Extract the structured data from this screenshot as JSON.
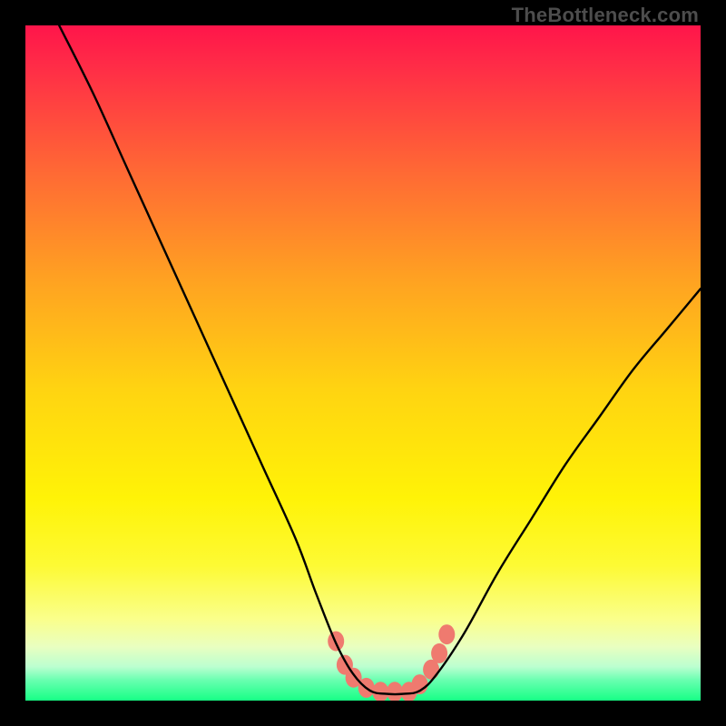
{
  "watermark": "TheBottleneck.com",
  "colors": {
    "frame": "#000000",
    "curve": "#000000",
    "beads": "#ef7a6f",
    "gradient_top": "#ff154a",
    "gradient_bottom": "#17ff85"
  },
  "chart_data": {
    "type": "line",
    "title": "",
    "xlabel": "",
    "ylabel": "",
    "xlim": [
      0,
      100
    ],
    "ylim": [
      0,
      100
    ],
    "grid": false,
    "legend": false,
    "annotations": [
      "TheBottleneck.com"
    ],
    "series": [
      {
        "name": "curve",
        "x": [
          5,
          10,
          15,
          20,
          25,
          30,
          35,
          40,
          43,
          46,
          48.5,
          51,
          53.5,
          56,
          58.5,
          61,
          65,
          70,
          75,
          80,
          85,
          90,
          95,
          100
        ],
        "y": [
          100,
          90,
          79,
          68,
          57,
          46,
          35,
          24,
          16,
          8.5,
          4,
          1.5,
          1,
          1,
          1.5,
          4,
          10,
          19,
          27,
          35,
          42,
          49,
          55,
          61
        ]
      }
    ],
    "beads": [
      {
        "x": 46.0,
        "y": 8.8
      },
      {
        "x": 47.3,
        "y": 5.3
      },
      {
        "x": 48.6,
        "y": 3.4
      },
      {
        "x": 50.5,
        "y": 1.9
      },
      {
        "x": 52.6,
        "y": 1.3
      },
      {
        "x": 54.7,
        "y": 1.3
      },
      {
        "x": 56.8,
        "y": 1.3
      },
      {
        "x": 58.4,
        "y": 2.4
      },
      {
        "x": 60.1,
        "y": 4.6
      },
      {
        "x": 61.3,
        "y": 7.0
      },
      {
        "x": 62.4,
        "y": 9.8
      }
    ]
  }
}
